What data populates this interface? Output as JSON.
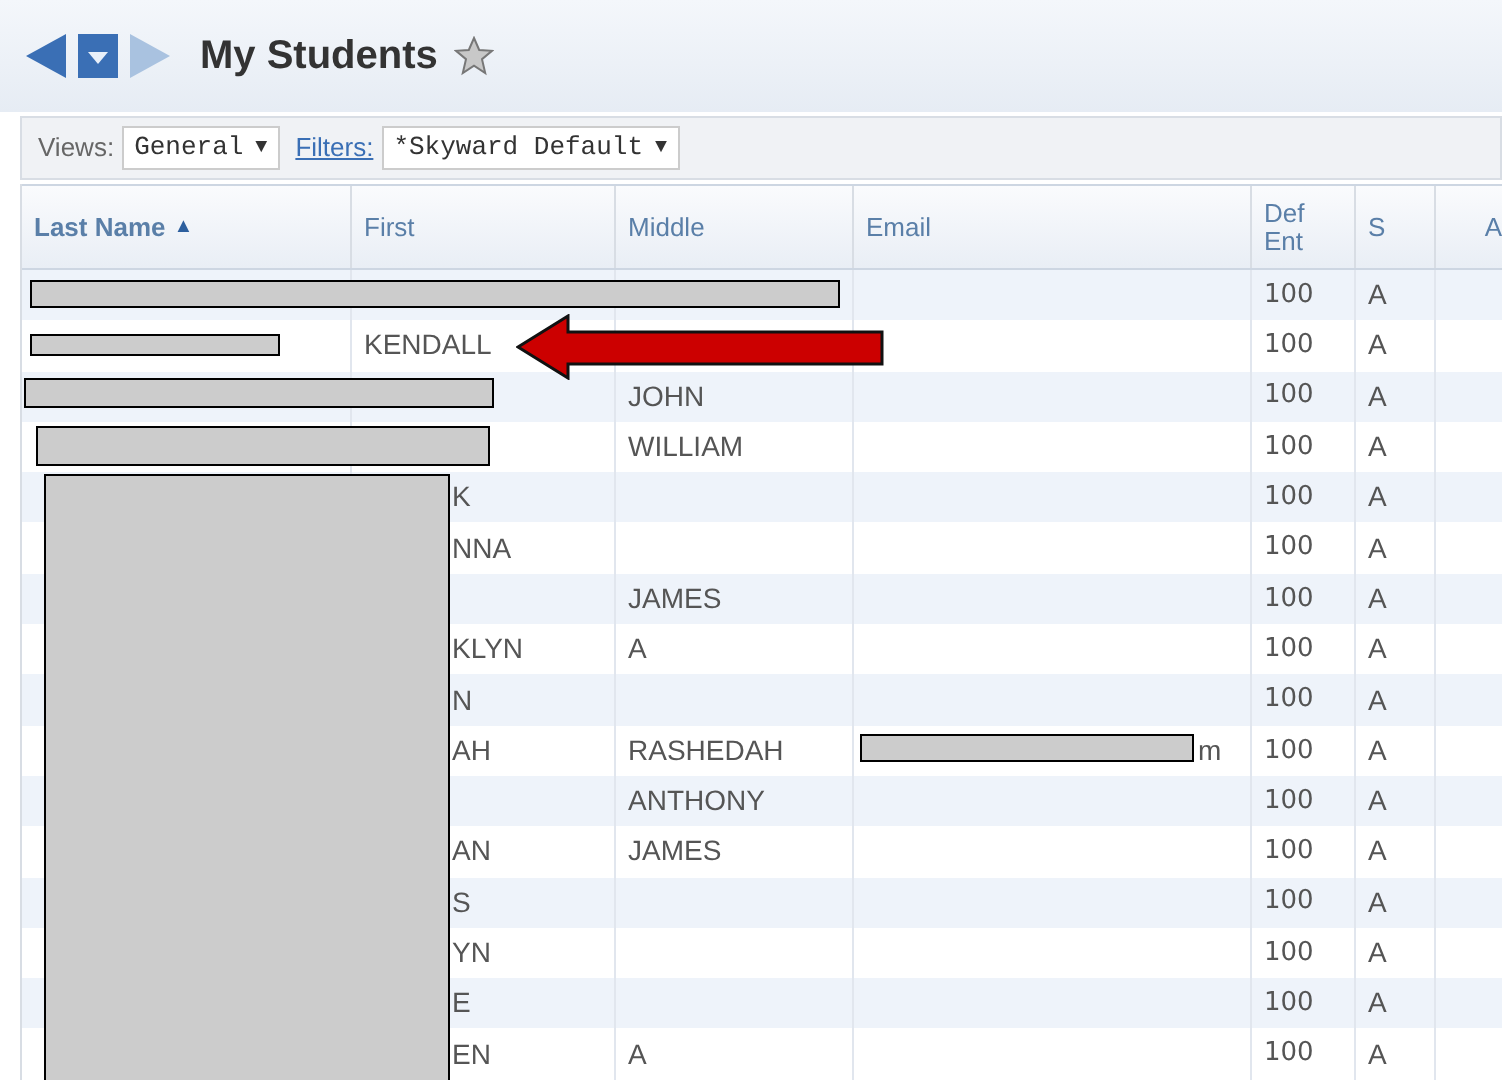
{
  "page": {
    "title": "My Students",
    "favorite": false
  },
  "filters": {
    "views_label": "Views:",
    "view": {
      "value": "General",
      "caret": "▼"
    },
    "filters_link": "Filters:",
    "filter": {
      "value": "*Skyward Default",
      "caret": "▼"
    }
  },
  "table": {
    "columns": [
      {
        "label": "Last Name",
        "sorted": true,
        "sort_mark": "▲"
      },
      {
        "label": "First",
        "sorted": false
      },
      {
        "label": "Middle",
        "sorted": false
      },
      {
        "label": "Email",
        "sorted": false
      },
      {
        "label": "Def Ent",
        "sorted": false
      },
      {
        "label": "S",
        "sorted": false
      },
      {
        "label": "A",
        "sorted": false
      }
    ],
    "rows": [
      {
        "last": "",
        "first": "",
        "middle": "",
        "email": "",
        "def_ent": "100",
        "s": "A"
      },
      {
        "last": "",
        "first": "KENDALL",
        "middle": "",
        "email": "",
        "def_ent": "100",
        "s": "A"
      },
      {
        "last": "",
        "first": "",
        "middle": "JOHN",
        "email": "",
        "def_ent": "100",
        "s": "A"
      },
      {
        "last": "",
        "first": "",
        "middle": "WILLIAM",
        "email": "",
        "def_ent": "100",
        "s": "A"
      },
      {
        "last": "",
        "first": "K",
        "middle": "",
        "email": "",
        "def_ent": "100",
        "s": "A"
      },
      {
        "last": "",
        "first": "NNA",
        "middle": "",
        "email": "",
        "def_ent": "100",
        "s": "A"
      },
      {
        "last": "",
        "first": "",
        "middle": "JAMES",
        "email": "",
        "def_ent": "100",
        "s": "A"
      },
      {
        "last": "",
        "first": "KLYN",
        "middle": "A",
        "email": "",
        "def_ent": "100",
        "s": "A"
      },
      {
        "last": "",
        "first": "N",
        "middle": "",
        "email": "",
        "def_ent": "100",
        "s": "A"
      },
      {
        "last": "",
        "first": "AH",
        "middle": "RASHEDAH",
        "email": "m",
        "def_ent": "100",
        "s": "A"
      },
      {
        "last": "",
        "first": "",
        "middle": "ANTHONY",
        "email": "",
        "def_ent": "100",
        "s": "A"
      },
      {
        "last": "",
        "first": "AN",
        "middle": "JAMES",
        "email": "",
        "def_ent": "100",
        "s": "A"
      },
      {
        "last": "",
        "first": "S",
        "middle": "",
        "email": "",
        "def_ent": "100",
        "s": "A"
      },
      {
        "last": "",
        "first": "YN",
        "middle": "",
        "email": "",
        "def_ent": "100",
        "s": "A"
      },
      {
        "last": "",
        "first": "E",
        "middle": "",
        "email": "",
        "def_ent": "100",
        "s": "A"
      },
      {
        "last": "",
        "first": "EN",
        "middle": "A",
        "email": "",
        "def_ent": "100",
        "s": "A"
      }
    ]
  }
}
